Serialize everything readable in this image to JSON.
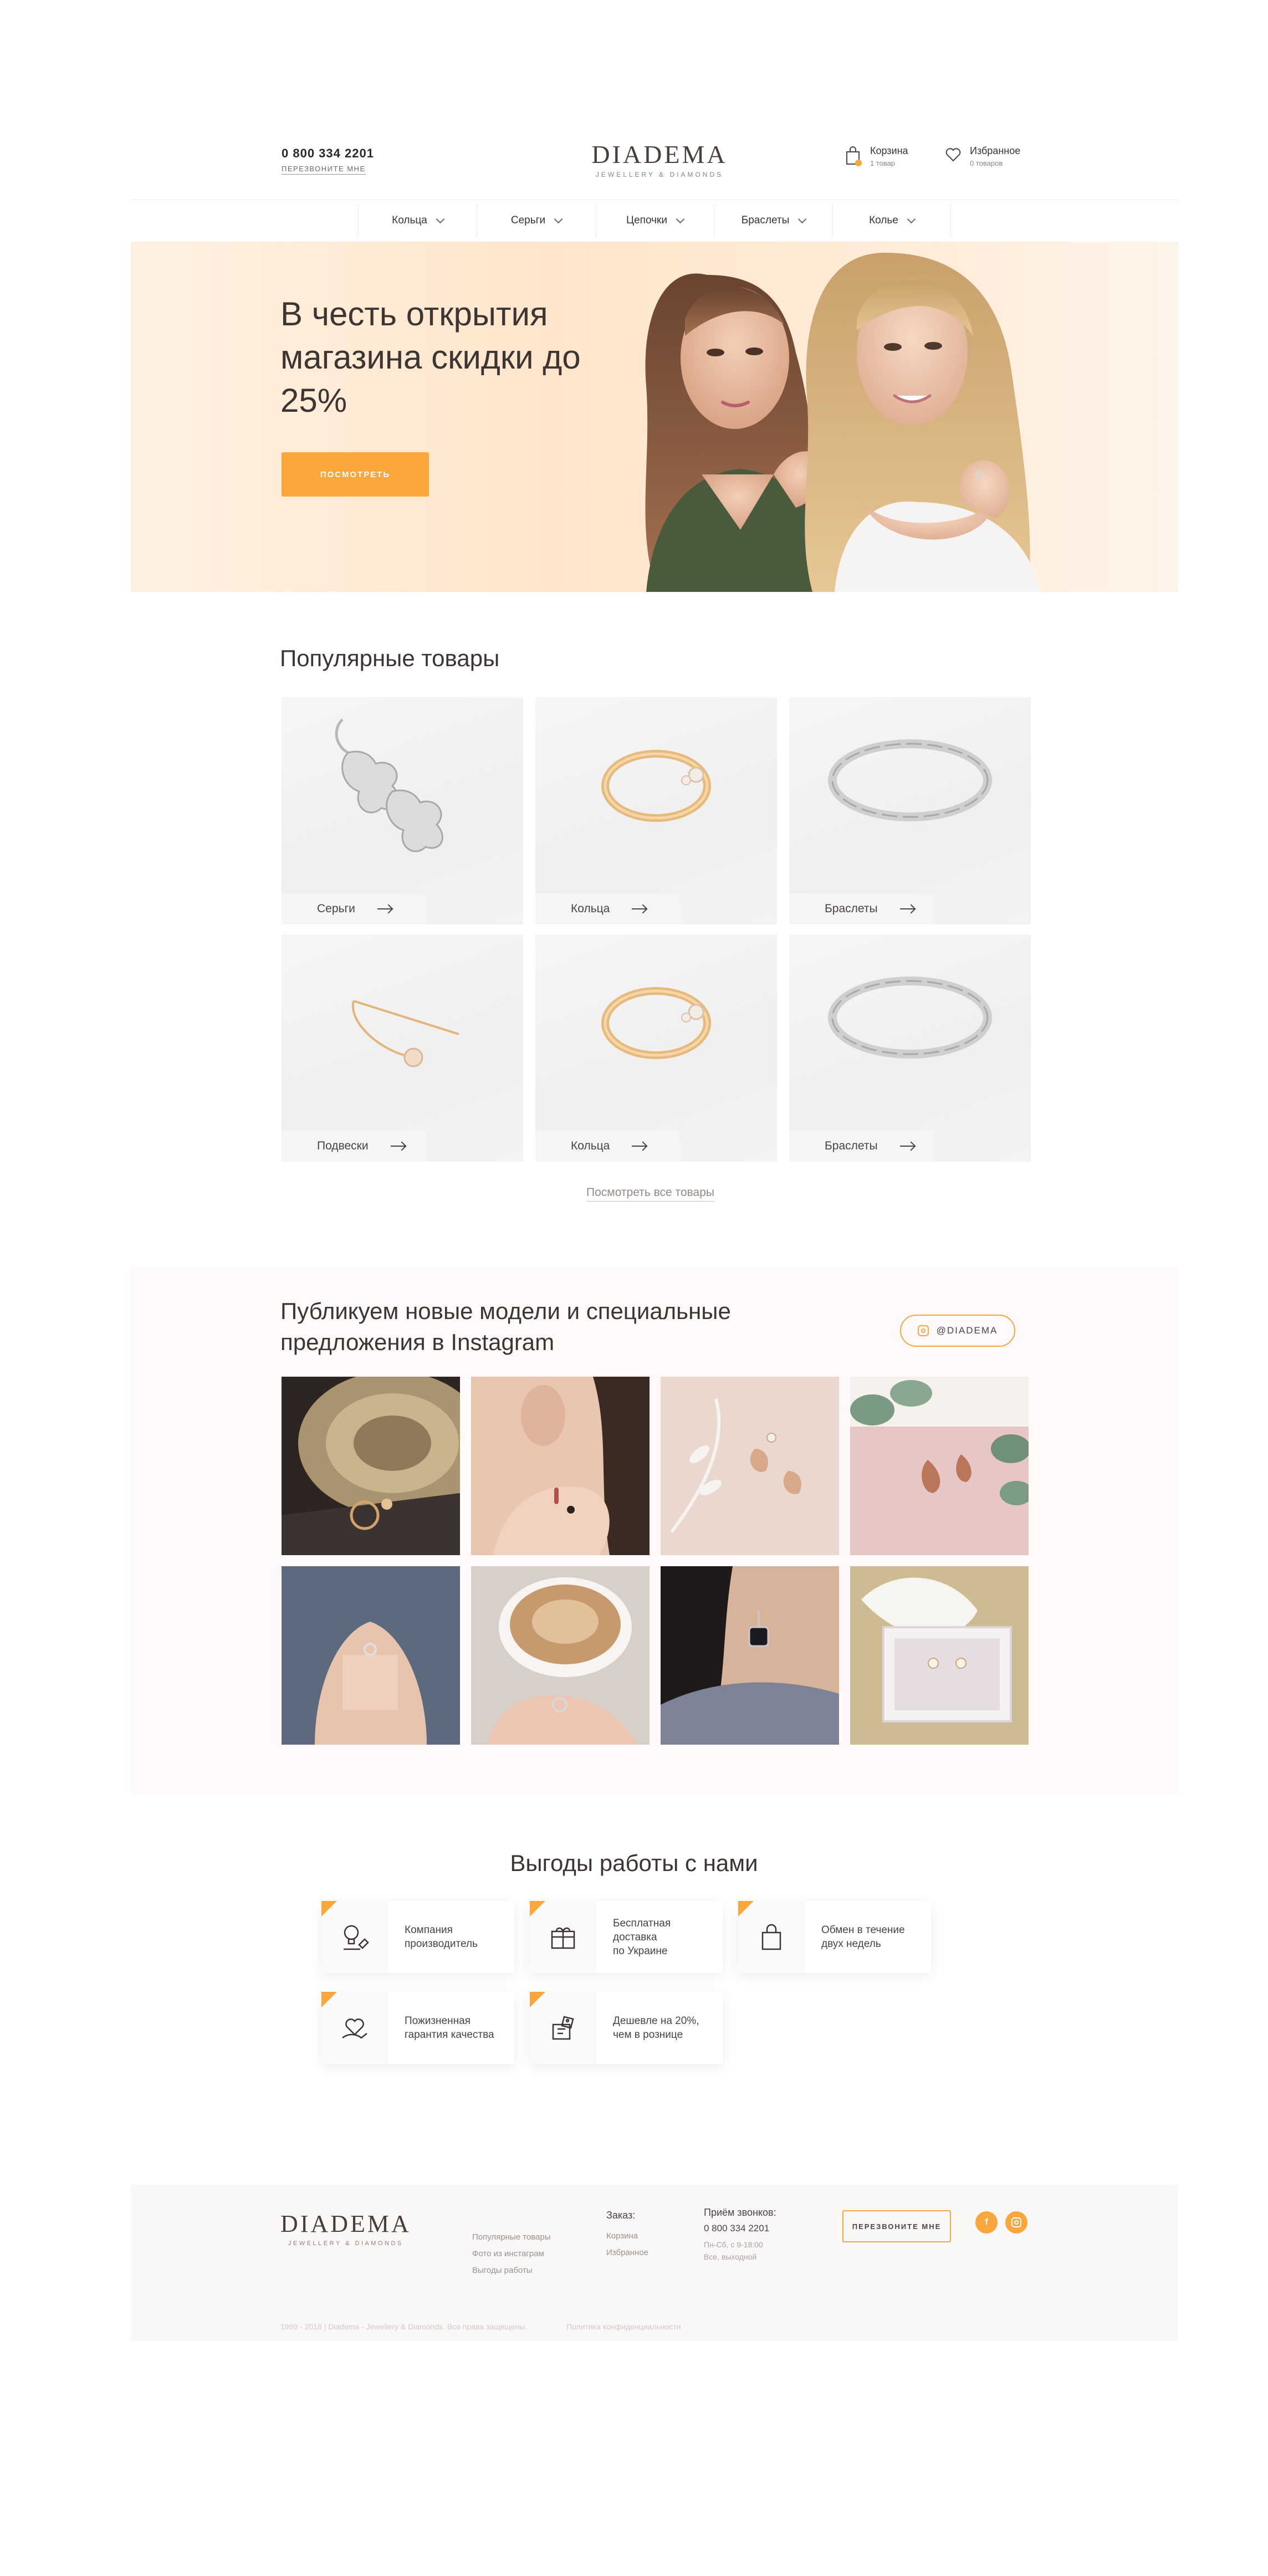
{
  "header": {
    "phone": "0 800 334 2201",
    "callback_link": "ПЕРЕЗВОНИТЕ МНЕ",
    "logo_main": "DIADEMA",
    "logo_sub": "JEWELLERY & DIAMONDS",
    "cart_title": "Корзина",
    "cart_count": "1 товар",
    "fav_title": "Избранное",
    "fav_count": "0 товаров"
  },
  "nav": {
    "items": [
      "Кольца",
      "Серьги",
      "Цепочки",
      "Браслеты",
      "Колье"
    ]
  },
  "hero": {
    "title": "В честь открытия магазина скидки до 25%",
    "button_label": "ПОСМОТРЕТЬ"
  },
  "popular": {
    "title": "Популярные товары",
    "products": [
      {
        "label": "Серьги",
        "icon": "earrings"
      },
      {
        "label": "Кольца",
        "icon": "gold-ring"
      },
      {
        "label": "Браслеты",
        "icon": "silver-bracelet"
      },
      {
        "label": "Подвески",
        "icon": "pin-pendant"
      },
      {
        "label": "Кольца",
        "icon": "gold-ring"
      },
      {
        "label": "Браслеты",
        "icon": "silver-bracelet"
      }
    ],
    "see_all": "Посмотреть все товары"
  },
  "instagram": {
    "title": "Публикуем новые модели и специальные предложения в Instagram",
    "handle": "@DIADEMA"
  },
  "benefits": {
    "title": "Выгоды работы с нами",
    "items": [
      {
        "text": "Компания\nпроизводитель",
        "icon": "idea-icon"
      },
      {
        "text": "Бесплатная\nдоставка\nпо Украине",
        "icon": "delivery-box-icon"
      },
      {
        "text": "Обмен в течение\nдвух недель",
        "icon": "shopping-bag-icon"
      },
      {
        "text": "Пожизненная\nгарантия качества",
        "icon": "heart-hand-icon"
      },
      {
        "text": "Дешевле на 20%,\nчем в рознице",
        "icon": "price-box-icon"
      }
    ]
  },
  "footer": {
    "logo_main": "DIADEMA",
    "logo_sub": "JEWELLERY & DIAMONDS",
    "links": [
      "Популярные товары",
      "Фото из инстаграм",
      "Выгоды работы"
    ],
    "order_title": "Заказ:",
    "order_links": [
      "Корзина",
      "Избранное"
    ],
    "calls_title": "Приём звонков:",
    "calls_phone": "0 800 334 2201",
    "calls_hours": "Пн-Сб, с 9-18:00\nВсе, выходной",
    "callback_button": "ПЕРЕЗВОНИТЕ МНЕ",
    "copyright": "1999 - 2018 | Diadema - Jewellery & Diamonds. Все права защищены.",
    "privacy": "Политика конфиденциальности"
  },
  "colors": {
    "accent": "#f9a63a",
    "text": "#3d3532",
    "hero_bg": "#ffe5cc",
    "insta_bg": "#fffaf9",
    "footer_bg": "#f9f8f6"
  }
}
